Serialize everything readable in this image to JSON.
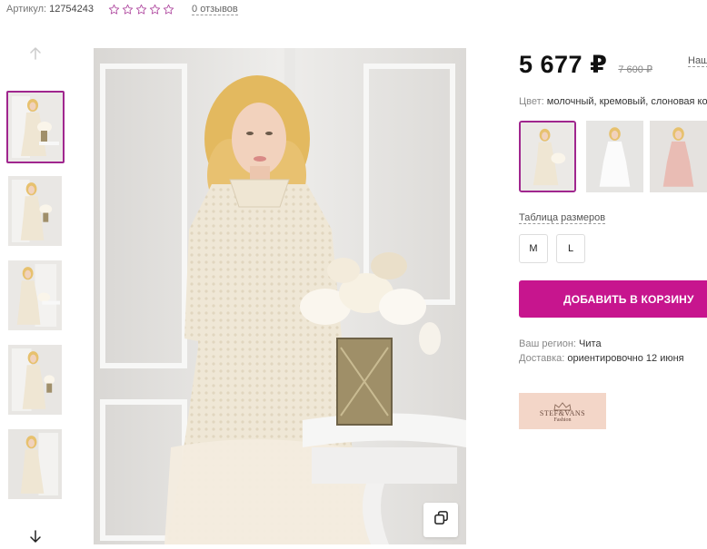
{
  "header": {
    "sku_label": "Артикул:",
    "sku_value": "12754243",
    "rating_stars": 0,
    "rating_max": 5,
    "reviews_link": "0 отзывов"
  },
  "gallery": {
    "thumbnails": [
      {
        "name": "thumb-1",
        "active": true
      },
      {
        "name": "thumb-2",
        "active": false
      },
      {
        "name": "thumb-3",
        "active": false
      },
      {
        "name": "thumb-4",
        "active": false
      },
      {
        "name": "thumb-5",
        "active": false
      }
    ],
    "arrow_up_icon": "arrow-up-icon",
    "arrow_down_icon": "arrow-down-icon",
    "zoom_icon": "copy-zoom-icon"
  },
  "product": {
    "price": "5 677 ₽",
    "old_price": "7 600 ₽",
    "cutoff_link": "Наш",
    "color_label": "Цвет:",
    "color_value": "молочный, кремовый, слоновая ко",
    "swatches": [
      {
        "name": "swatch-cream",
        "active": true
      },
      {
        "name": "swatch-white",
        "active": false
      },
      {
        "name": "swatch-pink",
        "active": false
      }
    ],
    "size_table_link": "Таблица размеров",
    "sizes": [
      "M",
      "L"
    ],
    "add_to_cart": "ДОБАВИТЬ В КОРЗИНУ",
    "region_label": "Ваш регион:",
    "region_value": "Чита",
    "delivery_label": "Доставка:",
    "delivery_value": "ориентировочно 12 июня",
    "brand_name": "STEF&VANS",
    "brand_sub": "Fashion"
  },
  "colors": {
    "accent": "#c7158e",
    "active_border": "#a0268e",
    "star_outline": "#b04aa0"
  }
}
